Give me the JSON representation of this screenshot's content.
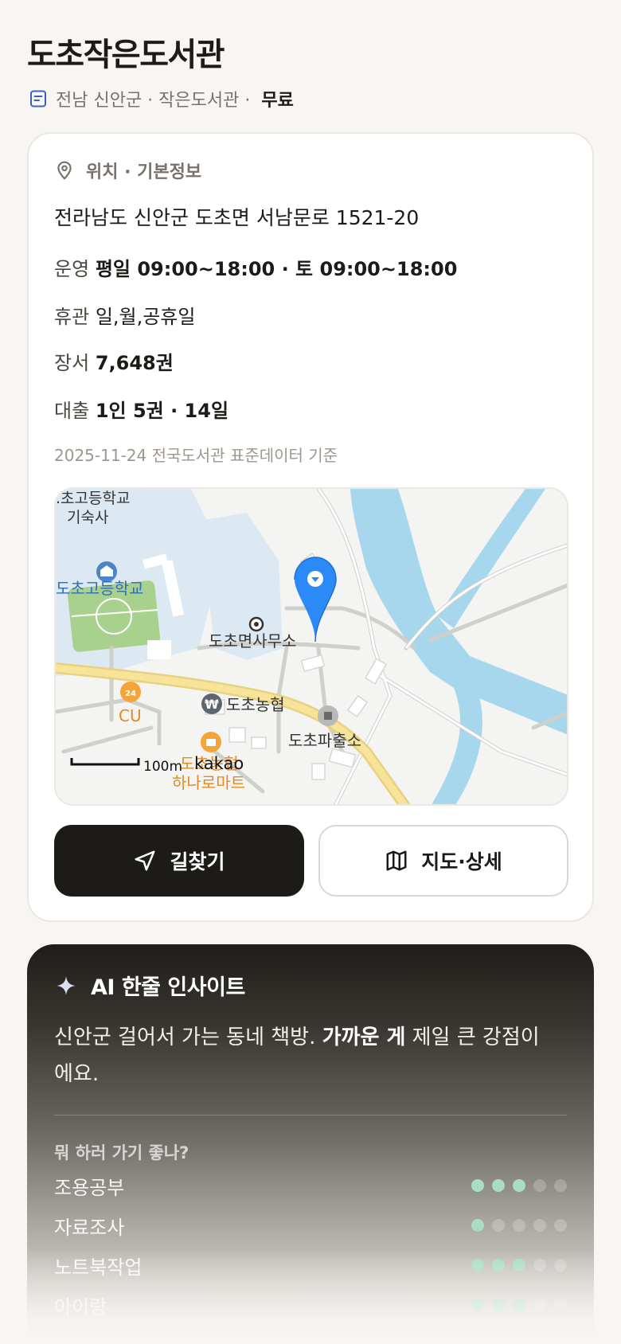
{
  "library": {
    "name": "도초작은도서관",
    "region_type": "전남 신안군 · 작은도서관 ·",
    "fee": "무료"
  },
  "info": {
    "section_title": "위치 · 기본정보",
    "address": "전라남도 신안군 도초면 서남문로 1521-20",
    "hours_label": "운영",
    "hours_value": "평일 09:00~18:00 · 토 09:00~18:00",
    "closed_label": "휴관",
    "closed_value": "일,월,공휴일",
    "books_label": "장서",
    "books_value": "7,648권",
    "loan_label": "대출",
    "loan_value": "1인 5권 · 14일",
    "source": "2025-11-24 전국도서관 표준데이터 기준"
  },
  "map": {
    "labels": {
      "school_dorm": ".초고등학교",
      "dorm": "기숙사",
      "school": "도초고등학교",
      "office": "도초면사무소",
      "nonghyup": "도초농협",
      "police": "도초파출소",
      "cu": "CU",
      "store": "도초농협",
      "store2": "하나로마트",
      "scale": "100m",
      "brand": "kakao"
    }
  },
  "buttons": {
    "directions": "길찾기",
    "map_detail": "지도·상세"
  },
  "ai": {
    "title": "AI 한줄 인사이트",
    "text_pre": "신안군 걸어서 가는 동네 책방. ",
    "text_bold": "가까운 게",
    "text_post": " 제일 큰 강점이에요.",
    "question": "뭐 하러 가기 좋나?",
    "activities": [
      {
        "name": "조용공부",
        "score": 3
      },
      {
        "name": "자료조사",
        "score": 1
      },
      {
        "name": "노트북작업",
        "score": 3
      },
      {
        "name": "아이랑",
        "score": 3
      }
    ]
  },
  "colors": {
    "accent_pin": "#2b8af7",
    "dot_on": "#a8dcc4",
    "dark": "#1d1b17"
  }
}
